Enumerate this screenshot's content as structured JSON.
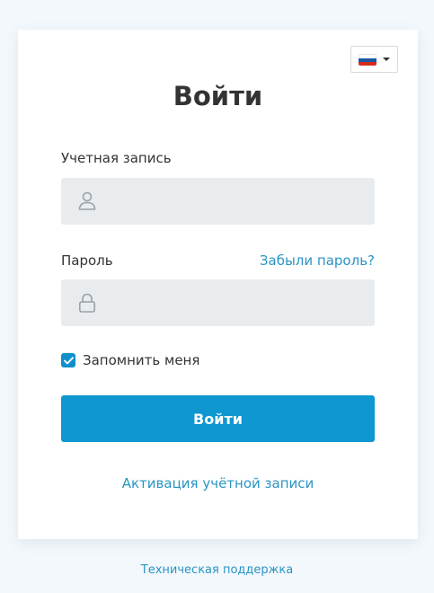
{
  "language": {
    "selected": "Русский",
    "flag_icon": "russia-flag-icon",
    "flag_colors": [
      "#ffffff",
      "#1c57a5",
      "#d52b1e"
    ]
  },
  "login": {
    "title": "Войти",
    "account_label": "Учетная запись",
    "account_value": "",
    "account_icon": "user-icon",
    "password_label": "Пароль",
    "password_value": "",
    "password_icon": "lock-icon",
    "forgot_password": "Забыли пароль?",
    "remember_me": "Запомнить меня",
    "remember_checked": true,
    "submit_label": "Войти",
    "activation_link": "Активация учётной записи"
  },
  "footer": {
    "support_link": "Техническая поддержка"
  },
  "colors": {
    "accent": "#0f97d2",
    "link": "#2a94c4",
    "field_bg": "#e9ecef",
    "page_bg": "#f3f8fc"
  }
}
